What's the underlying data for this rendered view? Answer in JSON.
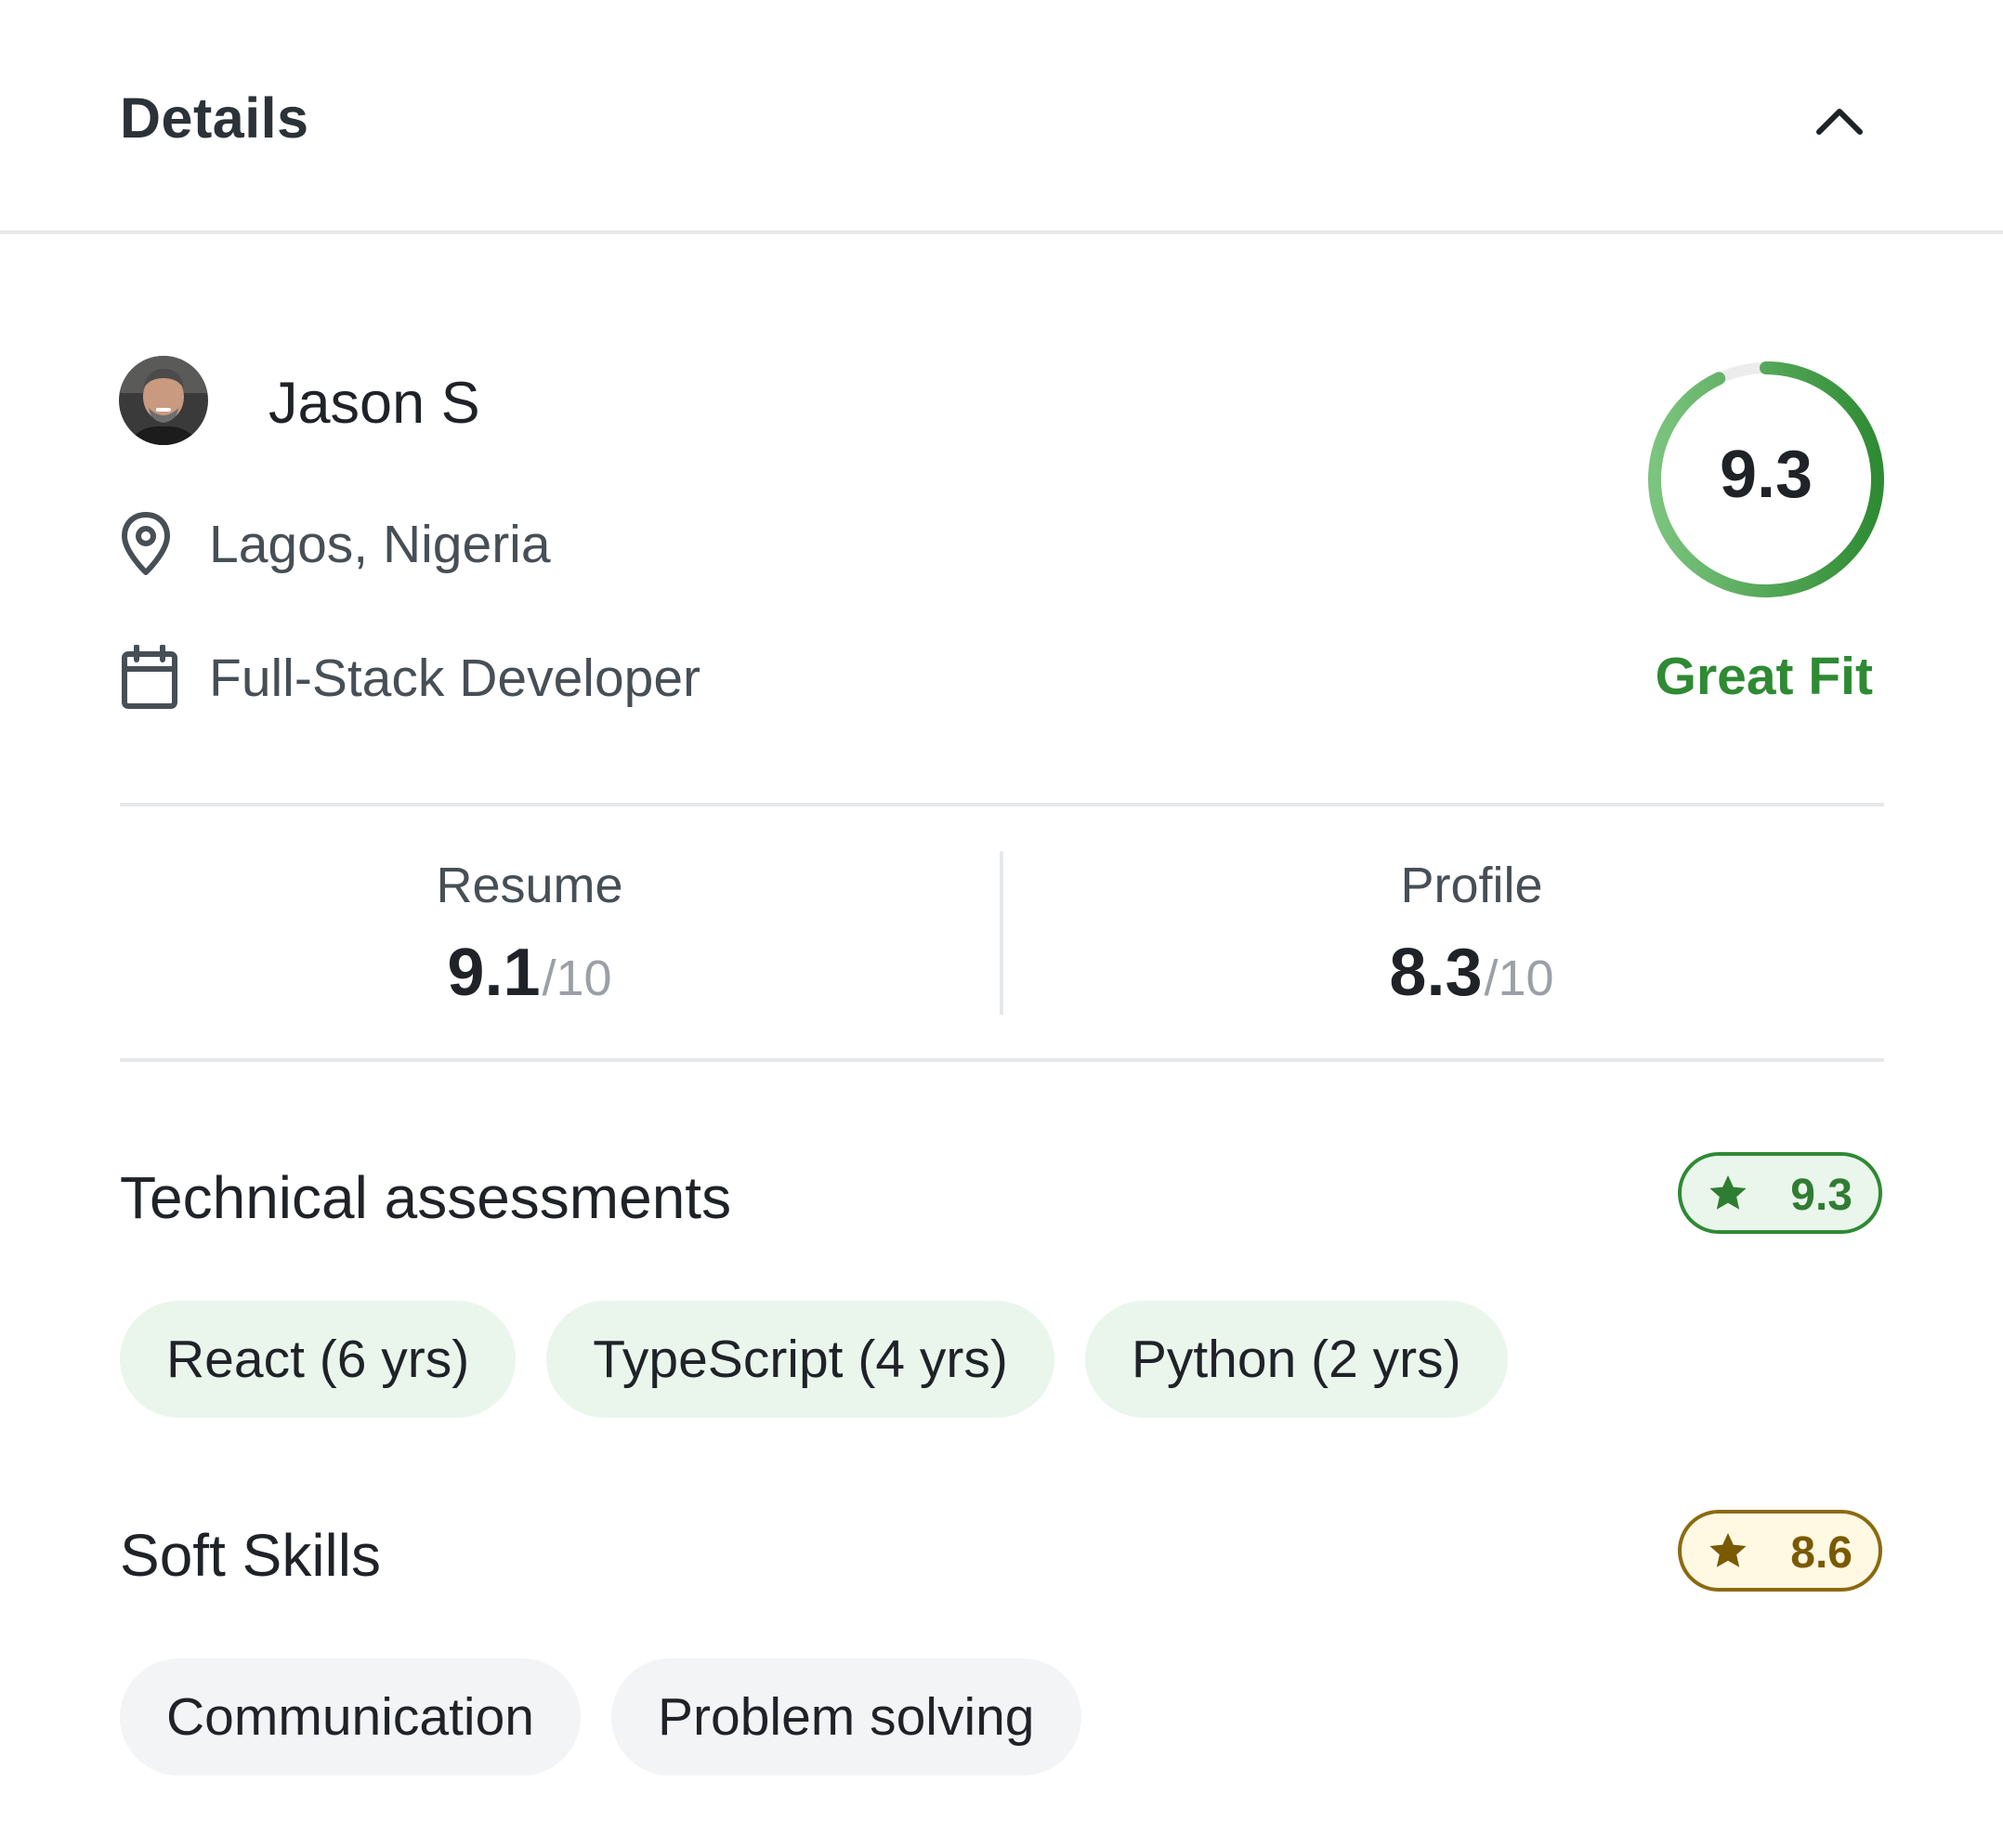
{
  "header": {
    "title": "Details",
    "collapse_icon": "chevron-up-icon"
  },
  "candidate": {
    "name": "Jason S",
    "location": "Lagos, Nigeria",
    "role": "Full-Stack Developer",
    "overall_score": "9.3",
    "overall_score_fraction": 0.93,
    "fit_label": "Great Fit"
  },
  "scores": {
    "resume": {
      "label": "Resume",
      "value": "9.1",
      "denominator": "/10"
    },
    "profile": {
      "label": "Profile",
      "value": "8.3",
      "denominator": "/10"
    }
  },
  "technical": {
    "title": "Technical assessments",
    "rating": "9.3",
    "chips": [
      "React (6 yrs)",
      "TypeScript (4 yrs)",
      "Python (2 yrs)"
    ]
  },
  "soft_skills": {
    "title": "Soft Skills",
    "rating": "8.6",
    "chips": [
      "Communication",
      "Problem solving"
    ]
  },
  "colors": {
    "accent_green": "#2f8a34",
    "gold": "#8b6a0f",
    "chip_green_bg": "#eaf6ec",
    "chip_gray_bg": "#f3f4f5"
  }
}
